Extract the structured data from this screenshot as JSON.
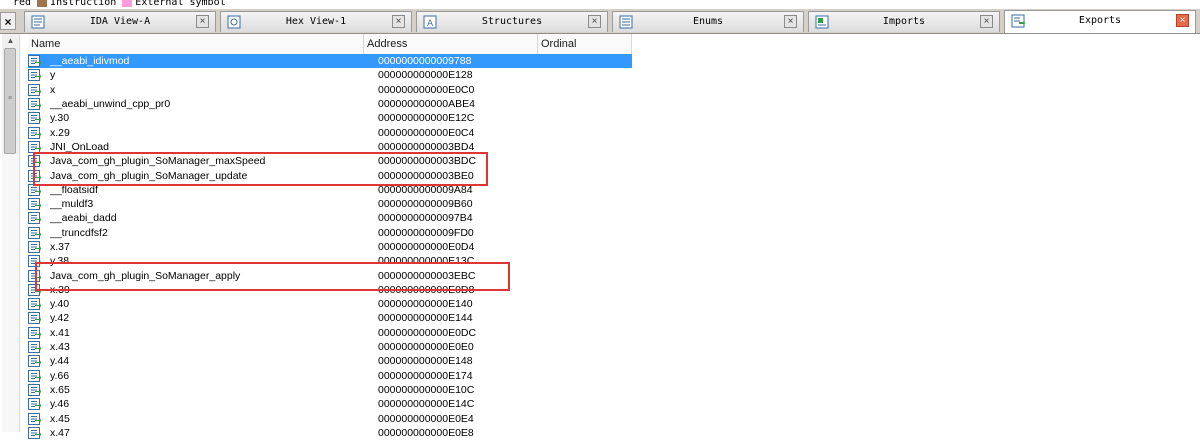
{
  "legend": [
    {
      "label": "red",
      "color": "#ffffff"
    },
    {
      "label": "Instruction",
      "color": "#a0744e"
    },
    {
      "label": "External symbol",
      "color": "#ff9adf"
    }
  ],
  "tabs": [
    {
      "label": "IDA View-A",
      "icon": "listing-icon",
      "active": false
    },
    {
      "label": "Hex View-1",
      "icon": "hex-icon",
      "active": false
    },
    {
      "label": "Structures",
      "icon": "structures-icon",
      "active": false
    },
    {
      "label": "Enums",
      "icon": "enums-icon",
      "active": false
    },
    {
      "label": "Imports",
      "icon": "imports-icon",
      "active": false
    },
    {
      "label": "Exports",
      "icon": "exports-icon",
      "active": true
    }
  ],
  "close_all_label": "×",
  "columns": {
    "name": "Name",
    "address": "Address",
    "ordinal": "Ordinal"
  },
  "rows": [
    {
      "name": "__aeabi_idivmod",
      "address": "0000000000009788",
      "ordinal": "",
      "selected": true
    },
    {
      "name": "y",
      "address": "000000000000E128",
      "ordinal": ""
    },
    {
      "name": "x",
      "address": "000000000000E0C0",
      "ordinal": ""
    },
    {
      "name": "__aeabi_unwind_cpp_pr0",
      "address": "000000000000ABE4",
      "ordinal": ""
    },
    {
      "name": "y.30",
      "address": "000000000000E12C",
      "ordinal": ""
    },
    {
      "name": "x.29",
      "address": "000000000000E0C4",
      "ordinal": ""
    },
    {
      "name": "JNI_OnLoad",
      "address": "0000000000003BD4",
      "ordinal": ""
    },
    {
      "name": "Java_com_gh_plugin_SoManager_maxSpeed",
      "address": "0000000000003BDC",
      "ordinal": ""
    },
    {
      "name": "Java_com_gh_plugin_SoManager_update",
      "address": "0000000000003BE0",
      "ordinal": ""
    },
    {
      "name": "__floatsidf",
      "address": "0000000000009A84",
      "ordinal": ""
    },
    {
      "name": "__muldf3",
      "address": "0000000000009B60",
      "ordinal": ""
    },
    {
      "name": "__aeabi_dadd",
      "address": "00000000000097B4",
      "ordinal": ""
    },
    {
      "name": "__truncdfsf2",
      "address": "0000000000009FD0",
      "ordinal": ""
    },
    {
      "name": "x.37",
      "address": "000000000000E0D4",
      "ordinal": ""
    },
    {
      "name": "y.38",
      "address": "000000000000E13C",
      "ordinal": ""
    },
    {
      "name": "Java_com_gh_plugin_SoManager_apply",
      "address": "0000000000003EBC",
      "ordinal": ""
    },
    {
      "name": "x.39",
      "address": "000000000000E0D8",
      "ordinal": ""
    },
    {
      "name": "y.40",
      "address": "000000000000E140",
      "ordinal": ""
    },
    {
      "name": "y.42",
      "address": "000000000000E144",
      "ordinal": ""
    },
    {
      "name": "x.41",
      "address": "000000000000E0DC",
      "ordinal": ""
    },
    {
      "name": "x.43",
      "address": "000000000000E0E0",
      "ordinal": ""
    },
    {
      "name": "y.44",
      "address": "000000000000E148",
      "ordinal": ""
    },
    {
      "name": "y.66",
      "address": "000000000000E174",
      "ordinal": ""
    },
    {
      "name": "x.65",
      "address": "000000000000E10C",
      "ordinal": ""
    },
    {
      "name": "y.46",
      "address": "000000000000E14C",
      "ordinal": ""
    },
    {
      "name": "x.45",
      "address": "000000000000E0E4",
      "ordinal": ""
    },
    {
      "name": "x.47",
      "address": "000000000000E0E8",
      "ordinal": ""
    }
  ],
  "colors": {
    "selection": "#3399ff",
    "highlight_box": "#e03535",
    "active_tab_close": "#e76a4a"
  }
}
